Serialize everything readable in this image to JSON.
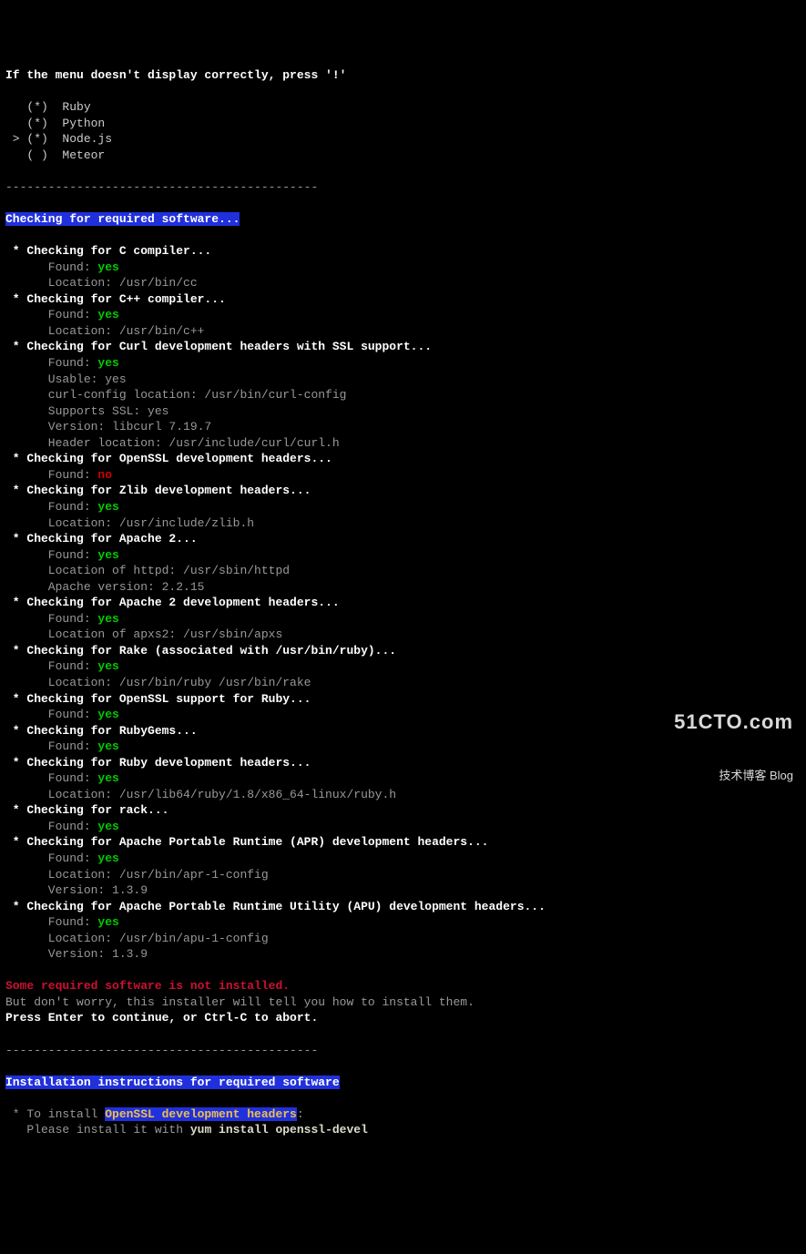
{
  "menu": {
    "warning": "If the menu doesn't display correctly, press '!'",
    "items": [
      {
        "marker": "   (*)  ",
        "label": "Ruby"
      },
      {
        "marker": "   (*)  ",
        "label": "Python"
      },
      {
        "marker": " > (*)  ",
        "label": "Node.js"
      },
      {
        "marker": "   ( )  ",
        "label": "Meteor"
      }
    ]
  },
  "divider": "--------------------------------------------",
  "section1": {
    "heading": "Checking for required software...",
    "checks": [
      {
        "title": " * Checking for C compiler...",
        "found_label": "      Found: ",
        "found_value": "yes",
        "found_class": "green",
        "lines": [
          "      Location: /usr/bin/cc"
        ]
      },
      {
        "title": " * Checking for C++ compiler...",
        "found_label": "      Found: ",
        "found_value": "yes",
        "found_class": "green",
        "lines": [
          "      Location: /usr/bin/c++"
        ]
      },
      {
        "title": " * Checking for Curl development headers with SSL support...",
        "found_label": "      Found: ",
        "found_value": "yes",
        "found_class": "green",
        "lines": [
          "      Usable: yes",
          "      curl-config location: /usr/bin/curl-config",
          "      Supports SSL: yes",
          "      Version: libcurl 7.19.7",
          "      Header location: /usr/include/curl/curl.h"
        ]
      },
      {
        "title": " * Checking for OpenSSL development headers...",
        "found_label": "      Found: ",
        "found_value": "no",
        "found_class": "red",
        "lines": []
      },
      {
        "title": " * Checking for Zlib development headers...",
        "found_label": "      Found: ",
        "found_value": "yes",
        "found_class": "green",
        "lines": [
          "      Location: /usr/include/zlib.h"
        ]
      },
      {
        "title": " * Checking for Apache 2...",
        "found_label": "      Found: ",
        "found_value": "yes",
        "found_class": "green",
        "lines": [
          "      Location of httpd: /usr/sbin/httpd",
          "      Apache version: 2.2.15"
        ]
      },
      {
        "title": " * Checking for Apache 2 development headers...",
        "found_label": "      Found: ",
        "found_value": "yes",
        "found_class": "green",
        "lines": [
          "      Location of apxs2: /usr/sbin/apxs"
        ]
      },
      {
        "title": " * Checking for Rake (associated with /usr/bin/ruby)...",
        "found_label": "      Found: ",
        "found_value": "yes",
        "found_class": "green",
        "lines": [
          "      Location: /usr/bin/ruby /usr/bin/rake"
        ]
      },
      {
        "title": " * Checking for OpenSSL support for Ruby...",
        "found_label": "      Found: ",
        "found_value": "yes",
        "found_class": "green",
        "lines": []
      },
      {
        "title": " * Checking for RubyGems...",
        "found_label": "      Found: ",
        "found_value": "yes",
        "found_class": "green",
        "lines": []
      },
      {
        "title": " * Checking for Ruby development headers...",
        "found_label": "      Found: ",
        "found_value": "yes",
        "found_class": "green",
        "lines": [
          "      Location: /usr/lib64/ruby/1.8/x86_64-linux/ruby.h"
        ]
      },
      {
        "title": " * Checking for rack...",
        "found_label": "      Found: ",
        "found_value": "yes",
        "found_class": "green",
        "lines": []
      },
      {
        "title": " * Checking for Apache Portable Runtime (APR) development headers...",
        "found_label": "      Found: ",
        "found_value": "yes",
        "found_class": "green",
        "lines": [
          "      Location: /usr/bin/apr-1-config",
          "      Version: 1.3.9"
        ]
      },
      {
        "title": " * Checking for Apache Portable Runtime Utility (APU) development headers...",
        "found_label": "      Found: ",
        "found_value": "yes",
        "found_class": "green",
        "lines": [
          "      Location: /usr/bin/apu-1-config",
          "      Version: 1.3.9"
        ]
      }
    ]
  },
  "error": {
    "line1": "Some required software is not installed.",
    "line2": "But don't worry, this installer will tell you how to install them.",
    "line3": "Press Enter to continue, or Ctrl-C to abort."
  },
  "section2": {
    "heading": "Installation instructions for required software",
    "item_prefix": " * To install ",
    "item_name": "OpenSSL development headers",
    "item_suffix": ":",
    "install_prefix": "   Please install it with ",
    "install_cmd": "yum install openssl-devel"
  },
  "watermark": {
    "big": "51CTO.com",
    "small": "技术博客",
    "badge": "Blog"
  }
}
